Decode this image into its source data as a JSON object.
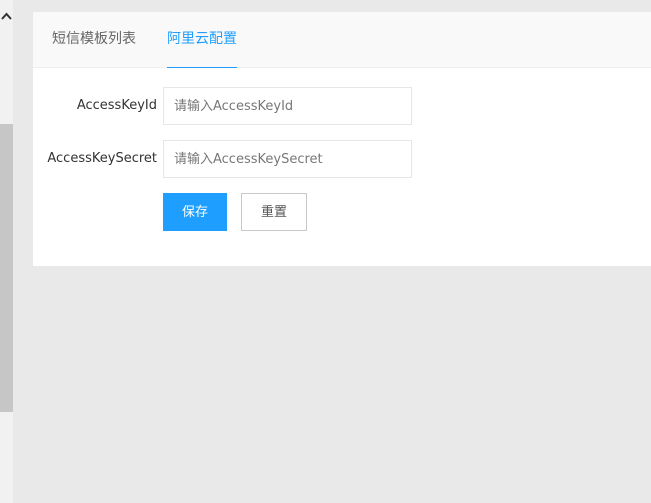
{
  "tabs": [
    {
      "label": "短信模板列表",
      "active": false
    },
    {
      "label": "阿里云配置",
      "active": true
    }
  ],
  "form": {
    "access_key_id": {
      "label": "AccessKeyId",
      "value": "",
      "placeholder": "请输入AccessKeyId"
    },
    "access_key_secret": {
      "label": "AccessKeySecret",
      "value": "",
      "placeholder": "请输入AccessKeySecret"
    }
  },
  "buttons": {
    "save_label": "保存",
    "reset_label": "重置"
  },
  "colors": {
    "accent": "#1e9fff",
    "background": "#e9e9e9",
    "panel": "#ffffff"
  }
}
